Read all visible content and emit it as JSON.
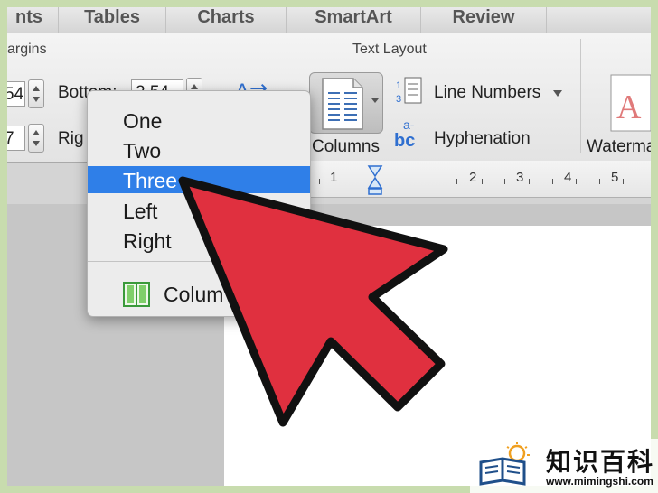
{
  "tabs": [
    "nts",
    "Tables",
    "Charts",
    "SmartArt",
    "Review"
  ],
  "ribbon": {
    "margins_label": "argins",
    "text_layout_label": "Text Layout",
    "bottom_label": "Bottom:",
    "bottom_value": "2.54",
    "left_value_top": "54",
    "right_label": "Rig",
    "left_value_bottom": "7",
    "columns_label": "Columns",
    "line_numbers_label": "Line Numbers",
    "hyphenation_label": "Hyphenation",
    "watermark_label": "Waterma"
  },
  "ruler": {
    "labels": [
      "1",
      "2",
      "3",
      "4",
      "5"
    ]
  },
  "menu": {
    "items": [
      "One",
      "Two",
      "Three",
      "Left",
      "Right"
    ],
    "selected_index": 2,
    "columns_item": "Colum"
  },
  "watermark": {
    "brand_cn": "知识百科",
    "url": "www.mimingshi.com"
  },
  "colors": {
    "selection": "#2f7fe8",
    "arrow": "#e0303f",
    "border": "#c8dcae"
  }
}
